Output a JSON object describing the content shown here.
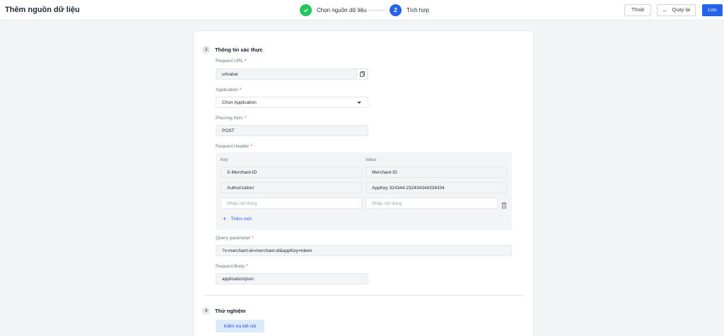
{
  "app_title": "Thêm nguồn dữ liệu",
  "steps": [
    {
      "label": "Chọn nguồn dữ liệu",
      "status": "done",
      "icon": "check-icon"
    },
    {
      "number": "2",
      "label": "Tích hợp",
      "status": "active"
    }
  ],
  "actions": {
    "exit": "Thoát",
    "back": "Quay lại",
    "save": "Lưu"
  },
  "colors": {
    "primary": "#2563eb",
    "success": "#22c55e",
    "required": "#ef4444"
  },
  "section3": {
    "number": "3",
    "title": "Thông tin xác thực",
    "request_url": {
      "label": "Request URL",
      "value": "urlvalue"
    },
    "application": {
      "label": "Application",
      "value": "Chọn Application"
    },
    "method": {
      "label": "Phương thức",
      "value": "POST"
    },
    "request_header": {
      "label": "Request Header",
      "key_col": "Key",
      "value_col": "Value",
      "rows": [
        {
          "key": "X-Merchant-ID",
          "value": "Merchant-ID"
        },
        {
          "key": "Authorization",
          "value": "AppKey 324344-232434344334334"
        }
      ],
      "key_placeholder": "Nhập nội dung",
      "value_placeholder": "Nhập nội dung",
      "add_label": "Thêm mới"
    },
    "query_parameter": {
      "label": "Query parameter",
      "value": "?x-merchant-id=merchant-id&appKey=token"
    },
    "request_body": {
      "label": "Request Body",
      "value": "application/json"
    }
  },
  "section4": {
    "number": "4",
    "title": "Thử nghiệm",
    "test_button": "Kiểm tra kết nối"
  }
}
